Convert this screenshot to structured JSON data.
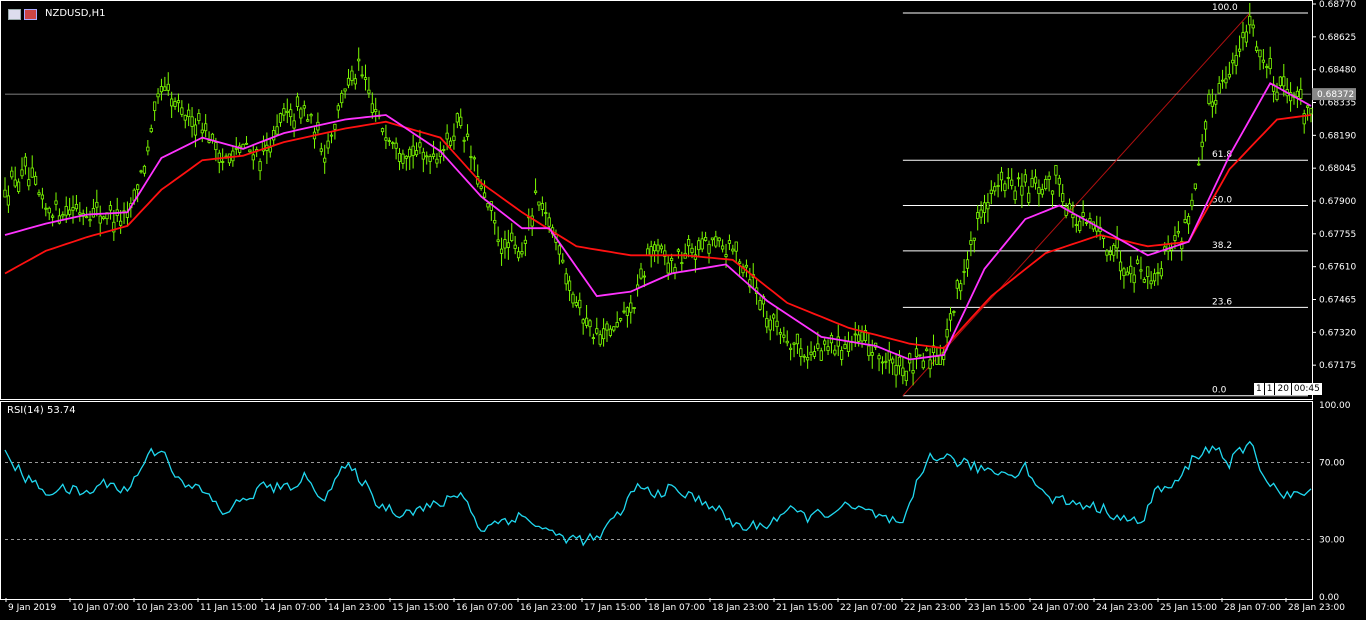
{
  "chart_header": {
    "symbol": "NZDUSD,H1",
    "rsi_label_prefix": "RSI(14)",
    "rsi_value": "53.74",
    "current_price": "0.68372",
    "timer": [
      "1",
      "1",
      "20",
      "00:45"
    ]
  },
  "colors": {
    "background": "#000000",
    "candles": "#7CFC00",
    "ma_fast": "#FF33FF",
    "ma_slow": "#FF1111",
    "rsi_line": "#20D8F0",
    "fib_lines": "#FFFFFF",
    "trendline": "#B01010",
    "grid_axis": "#FFFFFF"
  },
  "chart_data": [
    {
      "type": "line",
      "title": "NZDUSD,H1",
      "ylim": [
        0.6703,
        0.6877
      ],
      "y_ticks": [
        "0.68770",
        "0.68625",
        "0.68480",
        "0.68335",
        "0.68190",
        "0.68045",
        "0.67900",
        "0.67755",
        "0.67610",
        "0.67465",
        "0.67320",
        "0.67175"
      ],
      "x_ticks": [
        "9 Jan 2019",
        "10 Jan 07:00",
        "10 Jan 23:00",
        "11 Jan 15:00",
        "14 Jan 07:00",
        "14 Jan 23:00",
        "15 Jan 15:00",
        "16 Jan 07:00",
        "16 Jan 23:00",
        "17 Jan 15:00",
        "18 Jan 07:00",
        "18 Jan 23:00",
        "21 Jan 15:00",
        "22 Jan 07:00",
        "22 Jan 23:00",
        "23 Jan 15:00",
        "24 Jan 07:00",
        "24 Jan 23:00",
        "25 Jan 15:00",
        "28 Jan 07:00",
        "28 Jan 23:00"
      ],
      "price_path": [
        [
          0,
          0.6795
        ],
        [
          6,
          0.6802
        ],
        [
          12,
          0.6786
        ],
        [
          18,
          0.6787
        ],
        [
          24,
          0.6786
        ],
        [
          30,
          0.6784
        ],
        [
          36,
          0.6782
        ],
        [
          42,
          0.6812
        ],
        [
          46,
          0.684
        ],
        [
          52,
          0.6828
        ],
        [
          58,
          0.6825
        ],
        [
          64,
          0.6808
        ],
        [
          70,
          0.6813
        ],
        [
          76,
          0.681
        ],
        [
          82,
          0.6826
        ],
        [
          88,
          0.683
        ],
        [
          94,
          0.6812
        ],
        [
          100,
          0.684
        ],
        [
          104,
          0.6848
        ],
        [
          110,
          0.6825
        ],
        [
          116,
          0.6815
        ],
        [
          122,
          0.681
        ],
        [
          128,
          0.6812
        ],
        [
          134,
          0.6825
        ],
        [
          140,
          0.6795
        ],
        [
          146,
          0.677
        ],
        [
          152,
          0.6768
        ],
        [
          156,
          0.679
        ],
        [
          162,
          0.6775
        ],
        [
          168,
          0.6745
        ],
        [
          174,
          0.673
        ],
        [
          180,
          0.6733
        ],
        [
          186,
          0.6748
        ],
        [
          190,
          0.677
        ],
        [
          196,
          0.6762
        ],
        [
          202,
          0.6768
        ],
        [
          208,
          0.6772
        ],
        [
          214,
          0.6768
        ],
        [
          218,
          0.6762
        ],
        [
          224,
          0.674
        ],
        [
          230,
          0.673
        ],
        [
          236,
          0.6722
        ],
        [
          242,
          0.6725
        ],
        [
          248,
          0.6728
        ],
        [
          254,
          0.6726
        ],
        [
          260,
          0.6718
        ],
        [
          266,
          0.6715
        ],
        [
          272,
          0.6722
        ],
        [
          276,
          0.6725
        ],
        [
          282,
          0.676
        ],
        [
          288,
          0.679
        ],
        [
          294,
          0.6798
        ],
        [
          300,
          0.6795
        ],
        [
          306,
          0.6795
        ],
        [
          310,
          0.68
        ],
        [
          314,
          0.6782
        ],
        [
          320,
          0.6778
        ],
        [
          326,
          0.6768
        ],
        [
          330,
          0.6762
        ],
        [
          334,
          0.676
        ],
        [
          338,
          0.6756
        ],
        [
          342,
          0.677
        ],
        [
          346,
          0.6775
        ],
        [
          350,
          0.6795
        ],
        [
          354,
          0.683
        ],
        [
          358,
          0.6845
        ],
        [
          362,
          0.6852
        ],
        [
          366,
          0.687
        ],
        [
          370,
          0.6852
        ],
        [
          374,
          0.6842
        ],
        [
          378,
          0.6838
        ],
        [
          382,
          0.6832
        ],
        [
          384,
          0.683
        ]
      ],
      "ma_fast_path": [
        [
          0,
          0.6775
        ],
        [
          12,
          0.678
        ],
        [
          24,
          0.6784
        ],
        [
          36,
          0.6785
        ],
        [
          46,
          0.6809
        ],
        [
          58,
          0.6818
        ],
        [
          70,
          0.6813
        ],
        [
          82,
          0.682
        ],
        [
          100,
          0.6826
        ],
        [
          112,
          0.6828
        ],
        [
          128,
          0.6812
        ],
        [
          140,
          0.6792
        ],
        [
          152,
          0.6778
        ],
        [
          160,
          0.6778
        ],
        [
          174,
          0.6748
        ],
        [
          184,
          0.675
        ],
        [
          196,
          0.6758
        ],
        [
          212,
          0.6762
        ],
        [
          224,
          0.6746
        ],
        [
          240,
          0.673
        ],
        [
          256,
          0.6726
        ],
        [
          266,
          0.672
        ],
        [
          276,
          0.6722
        ],
        [
          288,
          0.676
        ],
        [
          300,
          0.6782
        ],
        [
          310,
          0.6788
        ],
        [
          322,
          0.6778
        ],
        [
          336,
          0.6766
        ],
        [
          348,
          0.6772
        ],
        [
          360,
          0.681
        ],
        [
          372,
          0.6842
        ],
        [
          384,
          0.6832
        ]
      ],
      "ma_slow_path": [
        [
          0,
          0.6758
        ],
        [
          12,
          0.6768
        ],
        [
          24,
          0.6774
        ],
        [
          36,
          0.6779
        ],
        [
          46,
          0.6795
        ],
        [
          58,
          0.6808
        ],
        [
          70,
          0.681
        ],
        [
          82,
          0.6816
        ],
        [
          100,
          0.6822
        ],
        [
          112,
          0.6825
        ],
        [
          128,
          0.6818
        ],
        [
          140,
          0.6798
        ],
        [
          152,
          0.6785
        ],
        [
          168,
          0.677
        ],
        [
          184,
          0.6766
        ],
        [
          200,
          0.6766
        ],
        [
          214,
          0.6764
        ],
        [
          230,
          0.6745
        ],
        [
          248,
          0.6734
        ],
        [
          266,
          0.6727
        ],
        [
          276,
          0.6725
        ],
        [
          290,
          0.6748
        ],
        [
          306,
          0.6767
        ],
        [
          322,
          0.6775
        ],
        [
          336,
          0.677
        ],
        [
          348,
          0.6772
        ],
        [
          360,
          0.6804
        ],
        [
          374,
          0.6826
        ],
        [
          384,
          0.6828
        ]
      ],
      "fibonacci": [
        {
          "level": "100.0",
          "price": 0.6873
        },
        {
          "level": "61.8",
          "price": 0.6808
        },
        {
          "level": "50.0",
          "price": 0.6788
        },
        {
          "level": "38.2",
          "price": 0.6768
        },
        {
          "level": "23.6",
          "price": 0.6743
        },
        {
          "level": "0.0",
          "price": 0.6704
        }
      ],
      "fib_start_index": 264,
      "current_price_line": 0.68372
    },
    {
      "type": "line",
      "title": "RSI(14) 53.74",
      "ylim": [
        0.0,
        100.0
      ],
      "y_ticks": [
        "100.00",
        "70.00",
        "30.00",
        "0.00"
      ],
      "levels": [
        70,
        30
      ],
      "values_path": [
        [
          0,
          74
        ],
        [
          6,
          62
        ],
        [
          12,
          55
        ],
        [
          18,
          56
        ],
        [
          24,
          54
        ],
        [
          30,
          60
        ],
        [
          36,
          55
        ],
        [
          42,
          74
        ],
        [
          46,
          78
        ],
        [
          52,
          58
        ],
        [
          58,
          56
        ],
        [
          64,
          44
        ],
        [
          70,
          50
        ],
        [
          76,
          58
        ],
        [
          82,
          56
        ],
        [
          88,
          62
        ],
        [
          94,
          52
        ],
        [
          100,
          68
        ],
        [
          104,
          63
        ],
        [
          110,
          48
        ],
        [
          116,
          44
        ],
        [
          122,
          46
        ],
        [
          128,
          48
        ],
        [
          134,
          55
        ],
        [
          140,
          35
        ],
        [
          146,
          40
        ],
        [
          152,
          42
        ],
        [
          156,
          38
        ],
        [
          162,
          32
        ],
        [
          168,
          30
        ],
        [
          174,
          30
        ],
        [
          180,
          42
        ],
        [
          186,
          58
        ],
        [
          190,
          54
        ],
        [
          196,
          56
        ],
        [
          202,
          52
        ],
        [
          208,
          48
        ],
        [
          214,
          38
        ],
        [
          218,
          36
        ],
        [
          224,
          38
        ],
        [
          230,
          45
        ],
        [
          236,
          42
        ],
        [
          242,
          44
        ],
        [
          248,
          47
        ],
        [
          254,
          44
        ],
        [
          260,
          40
        ],
        [
          264,
          36
        ],
        [
          268,
          58
        ],
        [
          272,
          74
        ],
        [
          278,
          72
        ],
        [
          284,
          68
        ],
        [
          290,
          66
        ],
        [
          296,
          64
        ],
        [
          300,
          68
        ],
        [
          306,
          52
        ],
        [
          312,
          50
        ],
        [
          318,
          48
        ],
        [
          324,
          45
        ],
        [
          330,
          40
        ],
        [
          334,
          38
        ],
        [
          338,
          55
        ],
        [
          344,
          58
        ],
        [
          350,
          74
        ],
        [
          356,
          78
        ],
        [
          360,
          70
        ],
        [
          366,
          80
        ],
        [
          370,
          64
        ],
        [
          376,
          52
        ],
        [
          382,
          54
        ],
        [
          384,
          53.74
        ]
      ]
    }
  ]
}
